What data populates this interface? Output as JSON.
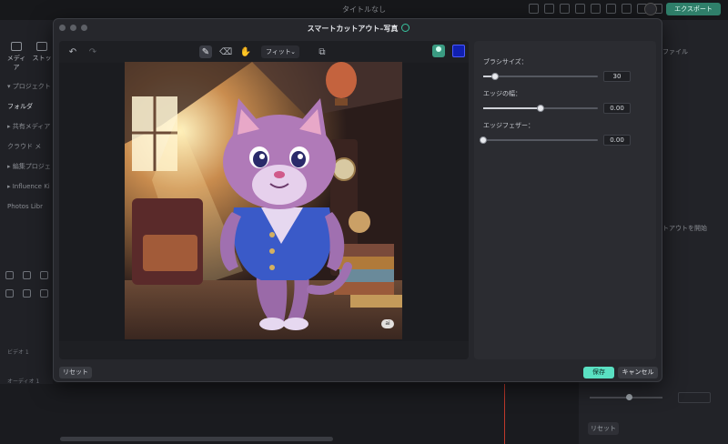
{
  "app": {
    "window_title": "タイトルなし",
    "export_label": "エクスポート",
    "left_tabs": [
      {
        "label": "メディア",
        "icon": "media-icon"
      },
      {
        "label": "ストッ",
        "icon": "stock-icon"
      }
    ],
    "left_items": [
      "▾ プロジェクト",
      "フォルダ",
      "▸ 共有メディア",
      "クラウド メ",
      "▸ 編集プロジェ",
      "▸ Influence Ki",
      "Photos Libr"
    ],
    "track_labels": [
      "ビデオ 1",
      "オーディオ 1"
    ],
    "right_text_top": "ファイル",
    "right_text_mid": "トアウトを開始",
    "right_reset": "リセット"
  },
  "modal": {
    "title": "スマートカットアウト–写真",
    "toolbar": {
      "undo_icon": "undo-icon",
      "redo_icon": "redo-icon",
      "brush_icon": "smart-brush-icon",
      "eraser_icon": "eraser-icon",
      "hand_icon": "hand-icon",
      "fit_label": "フィット",
      "compare_icon": "compare-icon",
      "person_icon": "person-preview-icon",
      "color_swatch": "#1020b0"
    },
    "image_badge": "ai",
    "settings": {
      "brush_size": {
        "label": "ブラシサイズ：",
        "value": "30",
        "fraction": 0.1
      },
      "edge_width": {
        "label": "エッジの幅：",
        "value": "0.00",
        "fraction": 0.5
      },
      "edge_feather": {
        "label": "エッジフェザー：",
        "value": "0.00",
        "fraction": 0.0
      }
    },
    "buttons": {
      "reset": "リセット",
      "save": "保存",
      "cancel": "キャンセル"
    },
    "colors": {
      "accent": "#5ae0c2"
    }
  }
}
